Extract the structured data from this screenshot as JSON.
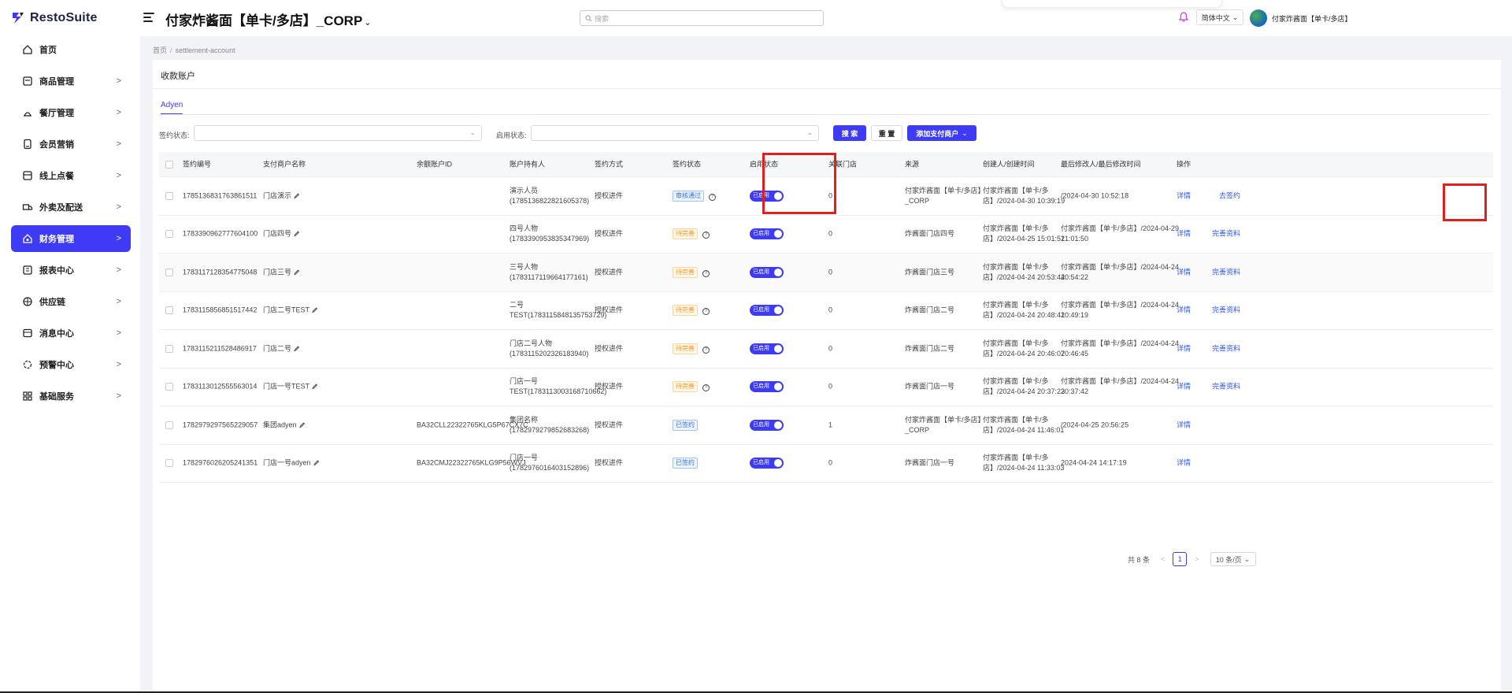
{
  "app": {
    "brand": "RestoSuite"
  },
  "sidebar": {
    "items": [
      {
        "label": "首页",
        "icon": "home-icon",
        "has_children": false
      },
      {
        "label": "商品管理",
        "icon": "goods-icon",
        "has_children": true
      },
      {
        "label": "餐厅管理",
        "icon": "restaurant-icon",
        "has_children": true
      },
      {
        "label": "会员营销",
        "icon": "member-icon",
        "has_children": true
      },
      {
        "label": "线上点餐",
        "icon": "online-order-icon",
        "has_children": true
      },
      {
        "label": "外卖及配送",
        "icon": "delivery-icon",
        "has_children": true
      },
      {
        "label": "财务管理",
        "icon": "finance-icon",
        "has_children": true,
        "active": true
      },
      {
        "label": "报表中心",
        "icon": "report-icon",
        "has_children": true
      },
      {
        "label": "供应链",
        "icon": "supply-chain-icon",
        "has_children": true
      },
      {
        "label": "消息中心",
        "icon": "message-icon",
        "has_children": true
      },
      {
        "label": "预警中心",
        "icon": "alert-icon",
        "has_children": true
      },
      {
        "label": "基础服务",
        "icon": "grid-icon",
        "has_children": true
      }
    ],
    "chevron": ">"
  },
  "header": {
    "store_title": "付家炸酱面【单卡/多店】_CORP",
    "search_placeholder": "搜索",
    "language": "简体中文",
    "user_name": "付家炸酱面【单卡/多店】"
  },
  "breadcrumb": {
    "home": "首页",
    "separator": "/",
    "current": "settlement-account"
  },
  "page": {
    "title": "收款账户",
    "tab": "Adyen",
    "filters": {
      "sign_status_label": "签约状态:",
      "enable_status_label": "启用状态:"
    },
    "buttons": {
      "search": "搜 索",
      "reset": "重 置",
      "add_merchant": "添加支付商户"
    }
  },
  "table": {
    "columns": [
      "签约编号",
      "支付商户名称",
      "余额账户ID",
      "账户持有人",
      "签约方式",
      "签约状态",
      "启用状态",
      "关联门店",
      "来源",
      "创建人/创建时间",
      "最后修改人/最后修改时间",
      "操作"
    ],
    "rows": [
      {
        "id": "1785136831763861511",
        "merchant": "门店演示",
        "balance_id": "",
        "holder1": "演示人员",
        "holder2": "(1785136822821605378)",
        "method": "授权进件",
        "status": "审核通过",
        "status_color": "blue",
        "status_help": true,
        "enabled": "已启用",
        "stores": "0",
        "source1": "付家炸酱面【单卡/多店】",
        "source2": "_CORP",
        "creator1": "付家炸酱面【单卡/多",
        "creator2": "店】/2024-04-30 10:39:19",
        "modifier1": "/2024-04-30 10:52:18",
        "modifier2": "",
        "action1": "详情",
        "action2": "去签约"
      },
      {
        "id": "1783390962777604100",
        "merchant": "门店四号",
        "balance_id": "",
        "holder1": "四号人物",
        "holder2": "(1783390953835347969)",
        "method": "授权进件",
        "status": "待完善",
        "status_color": "orange",
        "status_help": true,
        "enabled": "已启用",
        "stores": "0",
        "source1": "炸酱面门店四号",
        "source2": "",
        "creator1": "付家炸酱面【单卡/多",
        "creator2": "店】/2024-04-25 15:01:51",
        "modifier1": "付家炸酱面【单卡/多店】/2024-04-29",
        "modifier2": "21:01:50",
        "action1": "详情",
        "action2": "完善资料"
      },
      {
        "id": "1783117128354775048",
        "merchant": "门店三号",
        "balance_id": "",
        "holder1": "三号人物",
        "holder2": "(1783117119664177161)",
        "method": "授权进件",
        "status": "待完善",
        "status_color": "orange",
        "status_help": true,
        "enabled": "已启用",
        "stores": "0",
        "source1": "炸酱面门店三号",
        "source2": "",
        "creator1": "付家炸酱面【单卡/多",
        "creator2": "店】/2024-04-24 20:53:44",
        "modifier1": "付家炸酱面【单卡/多店】/2024-04-24",
        "modifier2": "20:54:22",
        "action1": "详情",
        "action2": "完善资料"
      },
      {
        "id": "1783115856851517442",
        "merchant": "门店二号TEST",
        "balance_id": "",
        "holder1": "二号",
        "holder2": "TEST(1783115848135753729)",
        "method": "授权进件",
        "status": "待完善",
        "status_color": "orange",
        "status_help": true,
        "enabled": "已启用",
        "stores": "0",
        "source1": "炸酱面门店二号",
        "source2": "",
        "creator1": "付家炸酱面【单卡/多",
        "creator2": "店】/2024-04-24 20:48:41",
        "modifier1": "付家炸酱面【单卡/多店】/2024-04-24",
        "modifier2": "20:49:19",
        "action1": "详情",
        "action2": "完善资料"
      },
      {
        "id": "1783115211528486917",
        "merchant": "门店二号",
        "balance_id": "",
        "holder1": "门店二号人物",
        "holder2": "(1783115202326183940)",
        "method": "授权进件",
        "status": "待完善",
        "status_color": "orange",
        "status_help": true,
        "enabled": "已启用",
        "stores": "0",
        "source1": "炸酱面门店二号",
        "source2": "",
        "creator1": "付家炸酱面【单卡/多",
        "creator2": "店】/2024-04-24 20:46:07",
        "modifier1": "付家炸酱面【单卡/多店】/2024-04-24",
        "modifier2": "20:46:45",
        "action1": "详情",
        "action2": "完善资料"
      },
      {
        "id": "1783113012555563014",
        "merchant": "门店一号TEST",
        "balance_id": "",
        "holder1": "门店一号",
        "holder2": "TEST(1783113003168710662)",
        "method": "授权进件",
        "status": "待完善",
        "status_color": "orange",
        "status_help": true,
        "enabled": "已启用",
        "stores": "0",
        "source1": "炸酱面门店一号",
        "source2": "",
        "creator1": "付家炸酱面【单卡/多",
        "creator2": "店】/2024-04-24 20:37:23",
        "modifier1": "付家炸酱面【单卡/多店】/2024-04-24",
        "modifier2": "20:37:42",
        "action1": "详情",
        "action2": "完善资料"
      },
      {
        "id": "1782979297565229057",
        "merchant": "集团adyen",
        "balance_id": "BA32CLL22322765KLG5P67CX7C",
        "holder1": "集团名称",
        "holder2": "(1782979279852683268)",
        "method": "授权进件",
        "status": "已签约",
        "status_color": "blue",
        "status_help": false,
        "enabled": "已启用",
        "stores": "1",
        "source1": "付家炸酱面【单卡/多店】",
        "source2": "_CORP",
        "creator1": "付家炸酱面【单卡/多",
        "creator2": "店】/2024-04-24 11:46:01",
        "modifier1": "/2024-04-25 20:56:25",
        "modifier2": "",
        "action1": "详情",
        "action2": ""
      },
      {
        "id": "1782976026205241351",
        "merchant": "门店一号adyen",
        "balance_id": "BA32CMJ22322765KLG9P56WVJ",
        "holder1": "门店一号",
        "holder2": "(1782976016403152896)",
        "method": "授权进件",
        "status": "已签约",
        "status_color": "blue",
        "status_help": false,
        "enabled": "已启用",
        "stores": "0",
        "source1": "炸酱面门店一号",
        "source2": "",
        "creator1": "付家炸酱面【单卡/多",
        "creator2": "店】/2024-04-24 11:33:03",
        "modifier1": "2024-04-24 14:17:19",
        "modifier2": "",
        "action1": "详情",
        "action2": ""
      }
    ]
  },
  "pagination": {
    "total": "共 8 条",
    "current_page": "1",
    "page_size": "10 条/页",
    "prev": "<",
    "next": ">"
  },
  "colors": {
    "primary": "#3d3bf3",
    "link": "#2f54eb",
    "highlight": "#e0201e"
  }
}
